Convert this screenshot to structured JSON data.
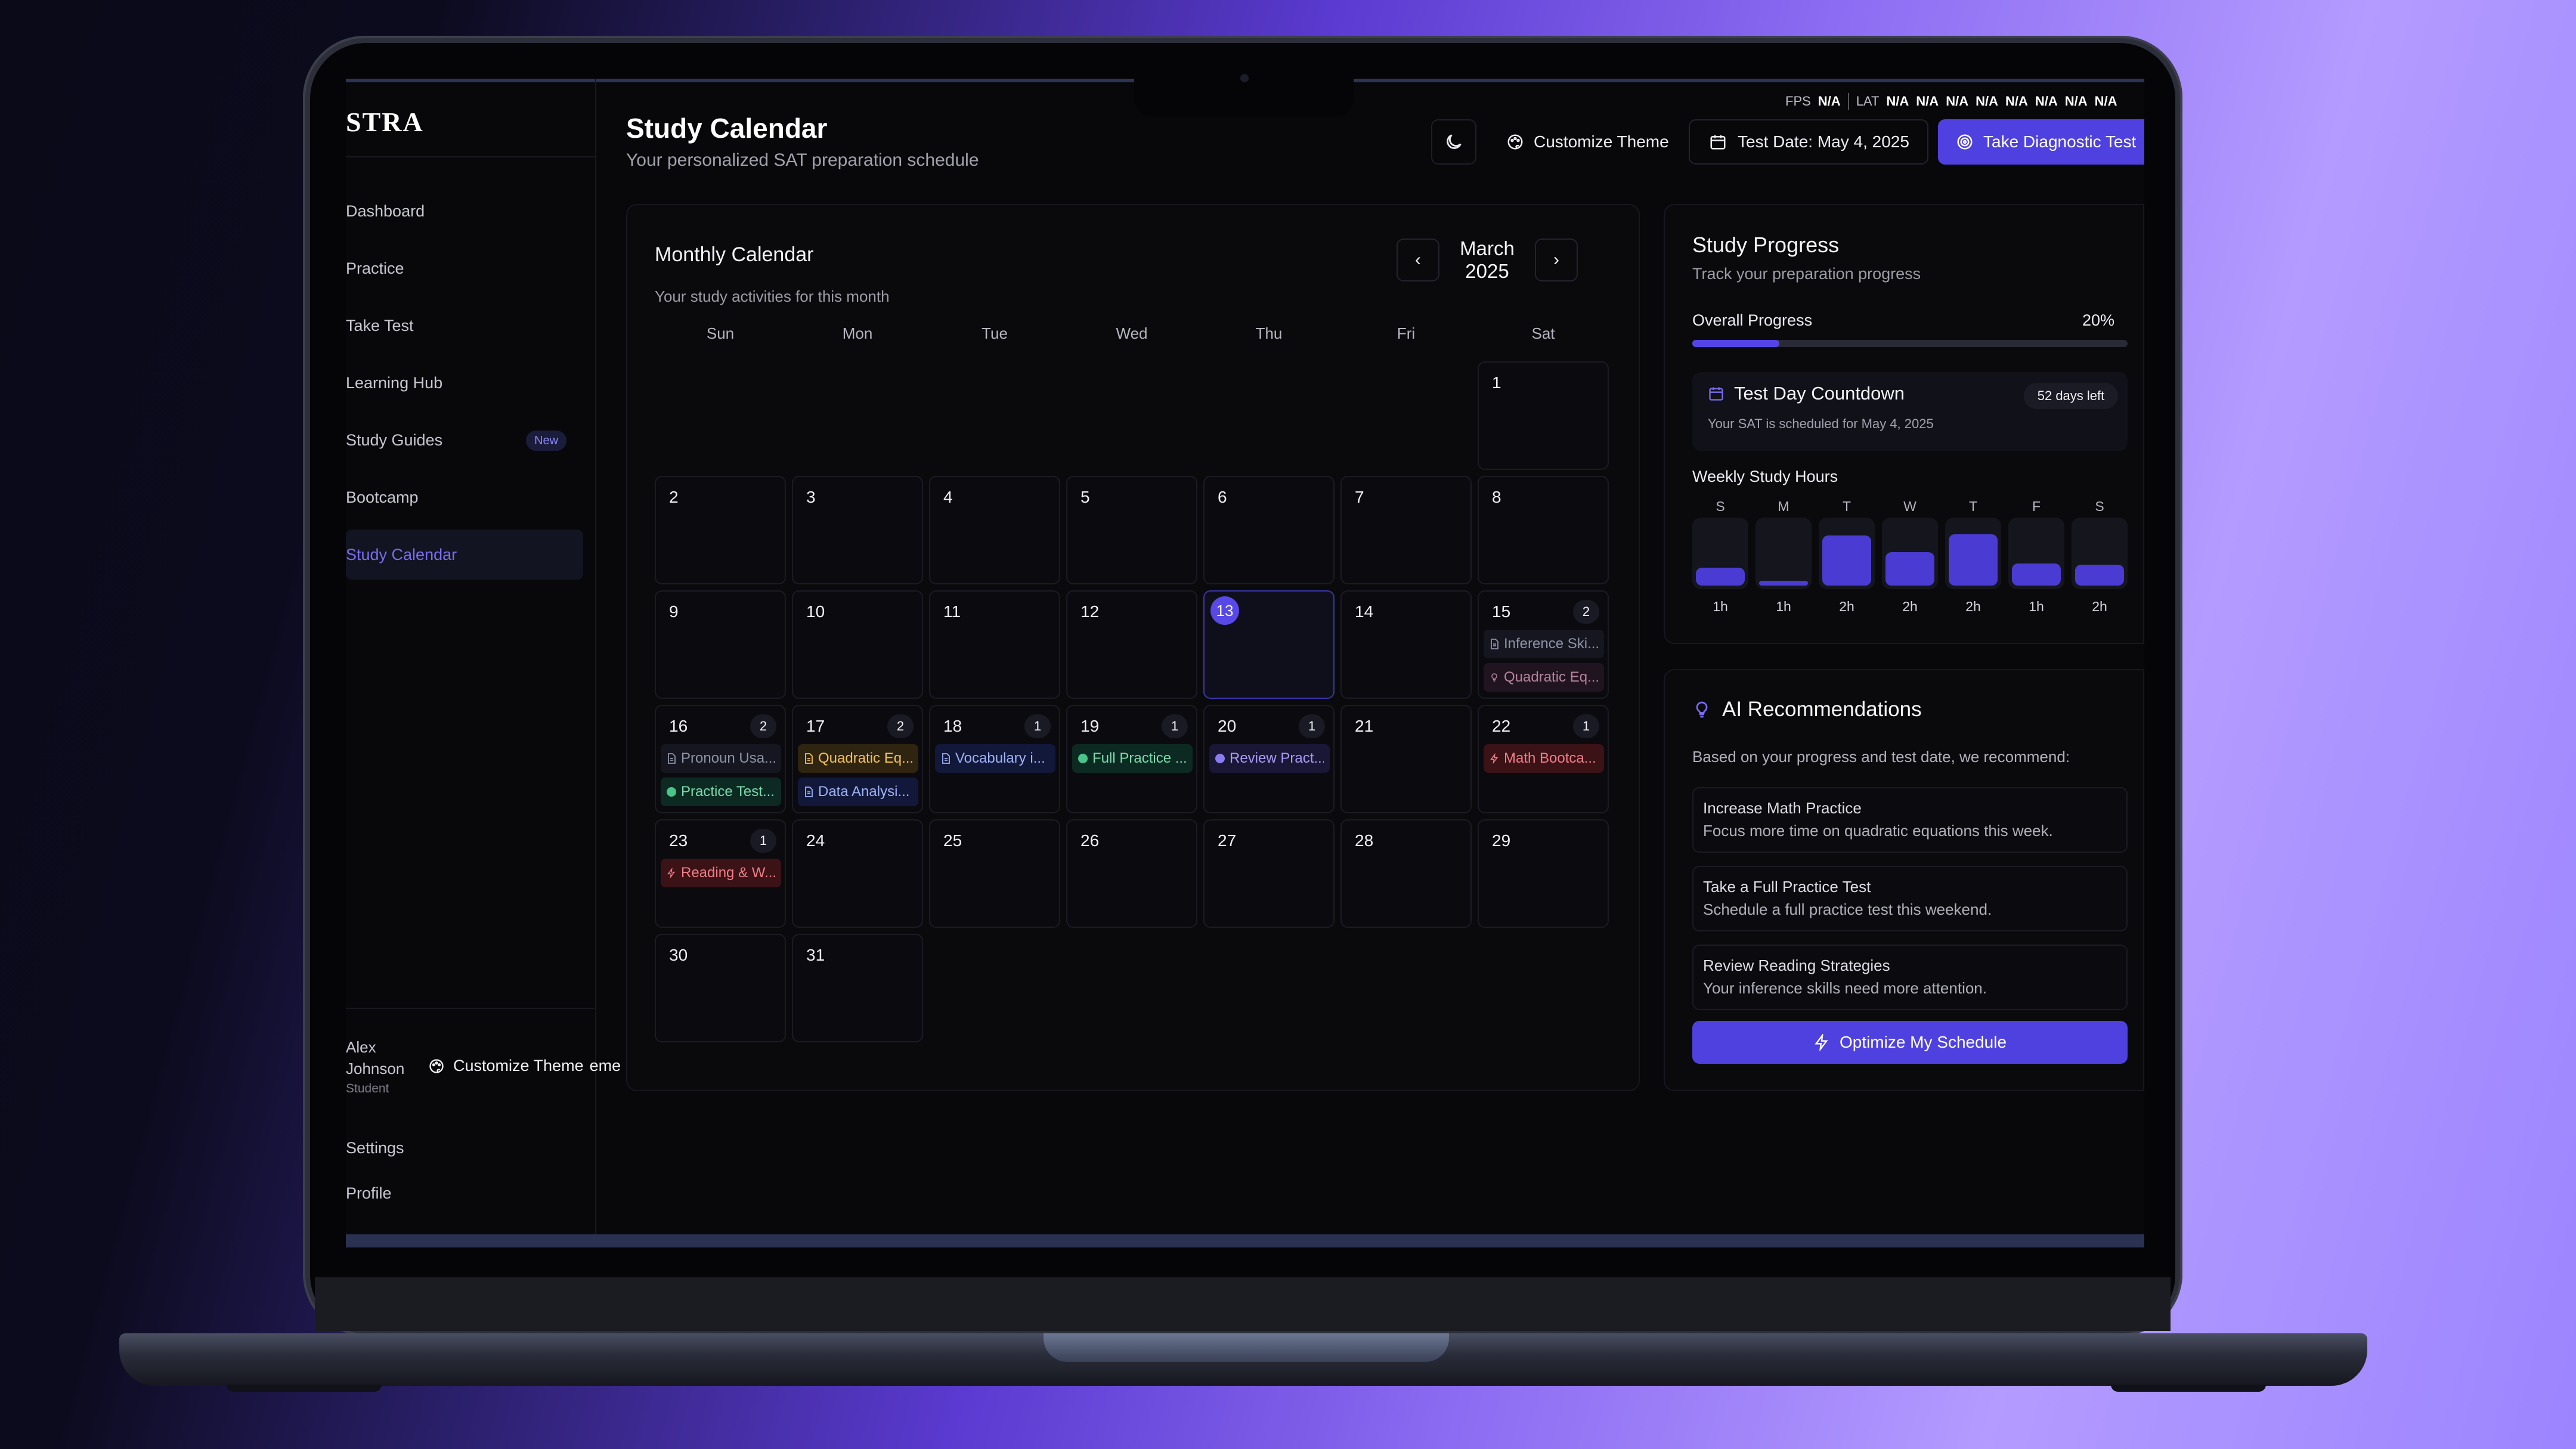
{
  "brand": {
    "logo": "STRA"
  },
  "perf": {
    "fps_label": "FPS",
    "fps_value": "N/A",
    "lat_label": "LAT",
    "lat_values": [
      "N/A",
      "N/A",
      "N/A",
      "N/A",
      "N/A",
      "N/A",
      "N/A",
      "N/A"
    ]
  },
  "sidebar": {
    "items": [
      {
        "label": "Dashboard"
      },
      {
        "label": "Practice"
      },
      {
        "label": "Take Test"
      },
      {
        "label": "Learning Hub"
      },
      {
        "label": "Study Guides",
        "badge": "New"
      },
      {
        "label": "Bootcamp"
      },
      {
        "label": "Study Calendar",
        "active": true
      }
    ],
    "user": {
      "name": "Alex Johnson",
      "role": "Student"
    },
    "theme_label": "Customize Theme",
    "theme_ghost": "eme",
    "links": {
      "settings": "Settings",
      "profile": "Profile"
    }
  },
  "header": {
    "title": "Study Calendar",
    "subtitle": "Your personalized SAT preparation schedule",
    "theme_button": "Customize Theme",
    "test_date_button": "Test Date: May 4, 2025",
    "diagnostic_button": "Take Diagnostic Test"
  },
  "calendar": {
    "title": "Monthly Calendar",
    "subtitle": "Your study activities for this month",
    "month": "March 2025",
    "weekdays": [
      "Sun",
      "Mon",
      "Tue",
      "Wed",
      "Thu",
      "Fri",
      "Sat"
    ],
    "first_weekday": 6,
    "days_in_month": 31,
    "today": 13,
    "events": {
      "15": {
        "count": "2",
        "items": [
          {
            "text": "Inference Ski...",
            "type": "gray",
            "icon": "doc"
          },
          {
            "text": "Quadratic Eq...",
            "type": "pink",
            "icon": "bulb"
          }
        ]
      },
      "16": {
        "count": "2",
        "items": [
          {
            "text": "Pronoun Usa...",
            "type": "gray",
            "icon": "doc"
          },
          {
            "text": "Practice Test...",
            "type": "green",
            "icon": "dot"
          }
        ]
      },
      "17": {
        "count": "2",
        "items": [
          {
            "text": "Quadratic Eq...",
            "type": "amber",
            "icon": "doc"
          },
          {
            "text": "Data Analysi...",
            "type": "blue",
            "icon": "doc"
          }
        ]
      },
      "18": {
        "count": "1",
        "items": [
          {
            "text": "Vocabulary i...",
            "type": "blue",
            "icon": "doc"
          }
        ]
      },
      "19": {
        "count": "1",
        "items": [
          {
            "text": "Full Practice ...",
            "type": "green",
            "icon": "dot"
          }
        ]
      },
      "20": {
        "count": "1",
        "items": [
          {
            "text": "Review Pract...",
            "type": "violet",
            "icon": "dot"
          }
        ]
      },
      "22": {
        "count": "1",
        "items": [
          {
            "text": "Math Bootca...",
            "type": "red",
            "icon": "bolt"
          }
        ]
      },
      "23": {
        "count": "1",
        "items": [
          {
            "text": "Reading & W...",
            "type": "red",
            "icon": "bolt"
          }
        ]
      }
    }
  },
  "progress": {
    "title": "Study Progress",
    "subtitle": "Track your preparation progress",
    "overall_label": "Overall Progress",
    "overall_value": "20%",
    "overall_fraction": 0.2,
    "countdown": {
      "title": "Test Day Countdown",
      "badge": "52 days left",
      "subtitle": "Your SAT is scheduled for May 4, 2025"
    },
    "weekly": {
      "title": "Weekly Study Hours",
      "days": [
        {
          "d": "S",
          "h": "1h",
          "level": 0.28
        },
        {
          "d": "M",
          "h": "1h",
          "level": 0.06
        },
        {
          "d": "T",
          "h": "2h",
          "level": 0.78
        },
        {
          "d": "W",
          "h": "2h",
          "level": 0.52
        },
        {
          "d": "T",
          "h": "2h",
          "level": 0.8
        },
        {
          "d": "F",
          "h": "1h",
          "level": 0.34
        },
        {
          "d": "S",
          "h": "2h",
          "level": 0.32
        }
      ]
    }
  },
  "ai": {
    "title": "AI Recommendations",
    "subtitle": "Based on your progress and test date, we recommend:",
    "recs": [
      {
        "title": "Increase Math Practice",
        "desc": "Focus more time on quadratic equations this week."
      },
      {
        "title": "Take a Full Practice Test",
        "desc": "Schedule a full practice test this weekend."
      },
      {
        "title": "Review Reading Strategies",
        "desc": "Your inference skills need more attention."
      }
    ],
    "button": "Optimize My Schedule"
  },
  "colors": {
    "accent": "#4e41e0",
    "background": "#08080b"
  }
}
